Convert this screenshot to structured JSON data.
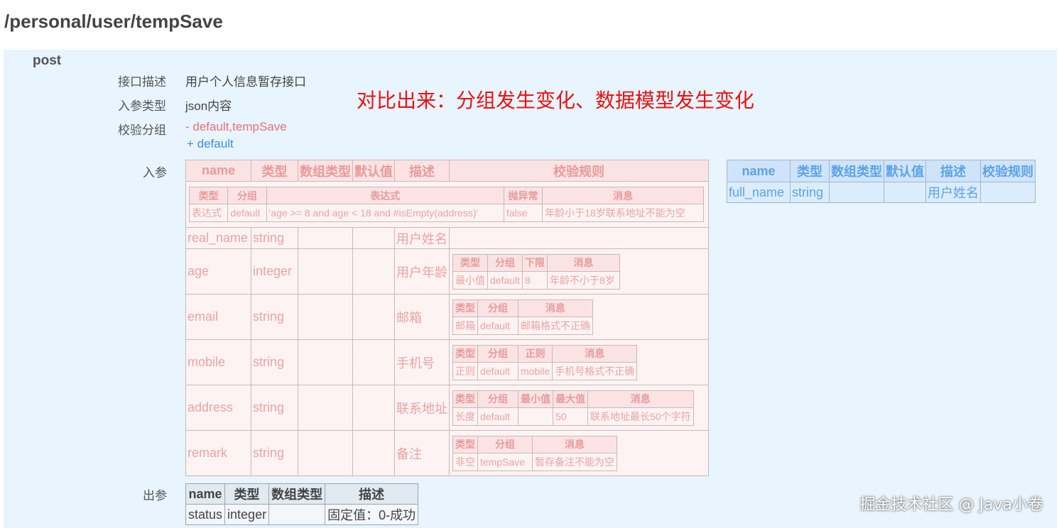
{
  "path": "/personal/user/tempSave",
  "method": "post",
  "labels": {
    "desc": "接口描述",
    "param_type": "入参类型",
    "group": "校验分组",
    "input": "入参",
    "output": "出参"
  },
  "desc_value": "用户个人信息暂存接口",
  "param_type_value": "json内容",
  "group_removed": "- default,tempSave",
  "group_added": "+ default",
  "headline": "对比出来：分组发生变化、数据模型发生变化",
  "watermark": "掘金技术社区 @ Java小卷",
  "input_table": {
    "headers": [
      "name",
      "类型",
      "数组类型",
      "默认值",
      "描述",
      "校验规则"
    ],
    "class_rule": {
      "headers": [
        "类型",
        "分组",
        "表达式",
        "抛异常",
        "消息"
      ],
      "row": [
        "表达式",
        "default",
        "'age >= 8 and age < 18 and #isEmpty(address)'",
        "false",
        "年龄小于18岁联系地址不能为空"
      ]
    },
    "rows": [
      {
        "name": "real_name",
        "type": "string",
        "arr": "",
        "def": "",
        "desc": "用户姓名"
      },
      {
        "name": "age",
        "type": "integer",
        "arr": "",
        "def": "",
        "desc": "用户年龄",
        "rule": {
          "headers": [
            "类型",
            "分组",
            "下限",
            "消息"
          ],
          "row": [
            "最小值",
            "default",
            "8",
            "年龄不小于8岁"
          ]
        }
      },
      {
        "name": "email",
        "type": "string",
        "arr": "",
        "def": "",
        "desc": "邮箱",
        "rule": {
          "headers": [
            "类型",
            "分组",
            "消息"
          ],
          "row": [
            "邮箱",
            "default",
            "邮箱格式不正确"
          ]
        }
      },
      {
        "name": "mobile",
        "type": "string",
        "arr": "",
        "def": "",
        "desc": "手机号",
        "rule": {
          "headers": [
            "类型",
            "分组",
            "正则",
            "消息"
          ],
          "row": [
            "正则",
            "default",
            "mobile",
            "手机号格式不正确"
          ]
        }
      },
      {
        "name": "address",
        "type": "string",
        "arr": "",
        "def": "",
        "desc": "联系地址",
        "rule": {
          "headers": [
            "类型",
            "分组",
            "最小值",
            "最大值",
            "消息"
          ],
          "row": [
            "长度",
            "default",
            "",
            "50",
            "联系地址最长50个字符"
          ]
        }
      },
      {
        "name": "remark",
        "type": "string",
        "arr": "",
        "def": "",
        "desc": "备注",
        "rule": {
          "headers": [
            "类型",
            "分组",
            "消息"
          ],
          "row": [
            "非空",
            "tempSave",
            "暂存备注不能为空"
          ]
        }
      }
    ]
  },
  "right_table": {
    "headers": [
      "name",
      "类型",
      "数组类型",
      "默认值",
      "描述",
      "校验规则"
    ],
    "row": [
      "full_name",
      "string",
      "",
      "",
      "用户姓名",
      ""
    ]
  },
  "output_table": {
    "headers": [
      "name",
      "类型",
      "数组类型",
      "描述"
    ],
    "row": [
      "status",
      "integer",
      "",
      "固定值：0-成功"
    ]
  }
}
